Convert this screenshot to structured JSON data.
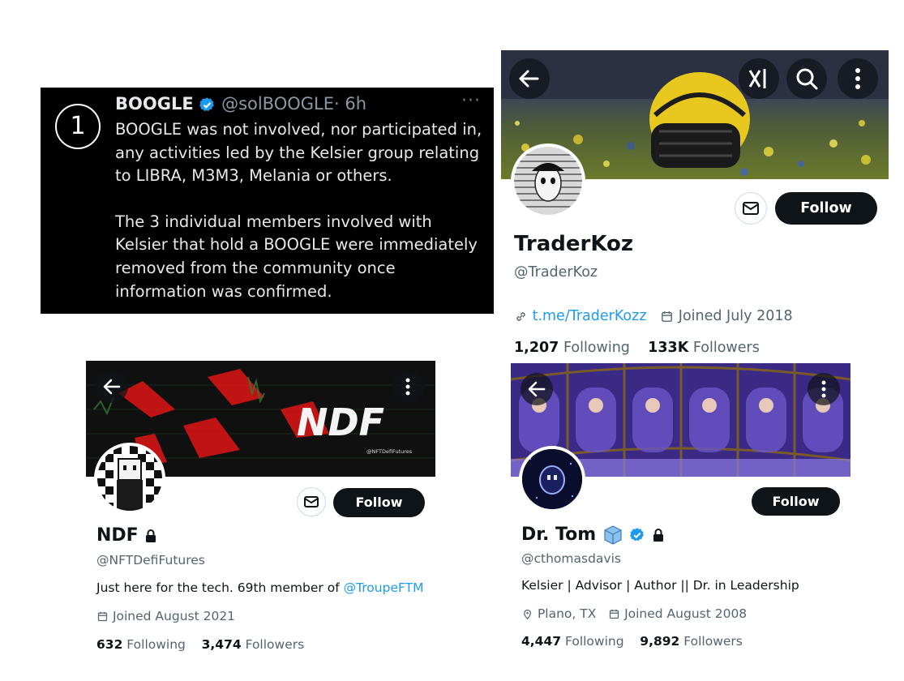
{
  "tweet": {
    "number": "1",
    "name": "BOOGLE",
    "handle": "@solBOOGLE",
    "time": "· 6h",
    "more": "···",
    "para1": "BOOGLE was not involved, nor participated in, any activities led by the Kelsier group relating to LIBRA, M3M3, Melania or others.",
    "para2": "The 3 individual members involved with Kelsier that hold a BOOGLE were immediately removed from the community once information was confirmed."
  },
  "traderkoz": {
    "name": "TraderKoz",
    "handle": "@TraderKoz",
    "link": "t.me/TraderKozz",
    "joined": "Joined July 2018",
    "following_count": "1,207",
    "following_label": "Following",
    "followers_count": "133K",
    "followers_label": "Followers",
    "follow_label": "Follow"
  },
  "ndf": {
    "name": "NDF",
    "handle": "@NFTDefiFutures",
    "bio_text": "Just here for the tech. 69th member of ",
    "bio_link": "@TroupeFTM",
    "joined": "Joined August 2021",
    "following_count": "632",
    "following_label": "Following",
    "followers_count": "3,474",
    "followers_label": "Followers",
    "follow_label": "Follow",
    "banner_logo": "NDF",
    "banner_tag": "@NFTDefiFutures"
  },
  "drtom": {
    "name": "Dr. Tom",
    "handle": "@cthomasdavis",
    "bio": "Kelsier | Advisor | Author || Dr. in Leadership",
    "location": "Plano, TX",
    "joined": "Joined August 2008",
    "following_count": "4,447",
    "following_label": "Following",
    "followers_count": "9,892",
    "followers_label": "Followers",
    "follow_label": "Follow"
  },
  "icons": {
    "back": "arrow-left-icon",
    "more": "vertical-dots-icon",
    "search": "search-icon",
    "grok": "grok-icon",
    "mail": "envelope-icon",
    "verified": "verified-badge-icon",
    "lock": "lock-icon",
    "calendar": "calendar-icon",
    "link": "link-icon",
    "location": "location-pin-icon",
    "cube": "cube-icon"
  },
  "colors": {
    "verified": "#1d9bf0",
    "link": "#1d9bf0",
    "muted": "#536471",
    "follow_bg": "#0f1419"
  }
}
